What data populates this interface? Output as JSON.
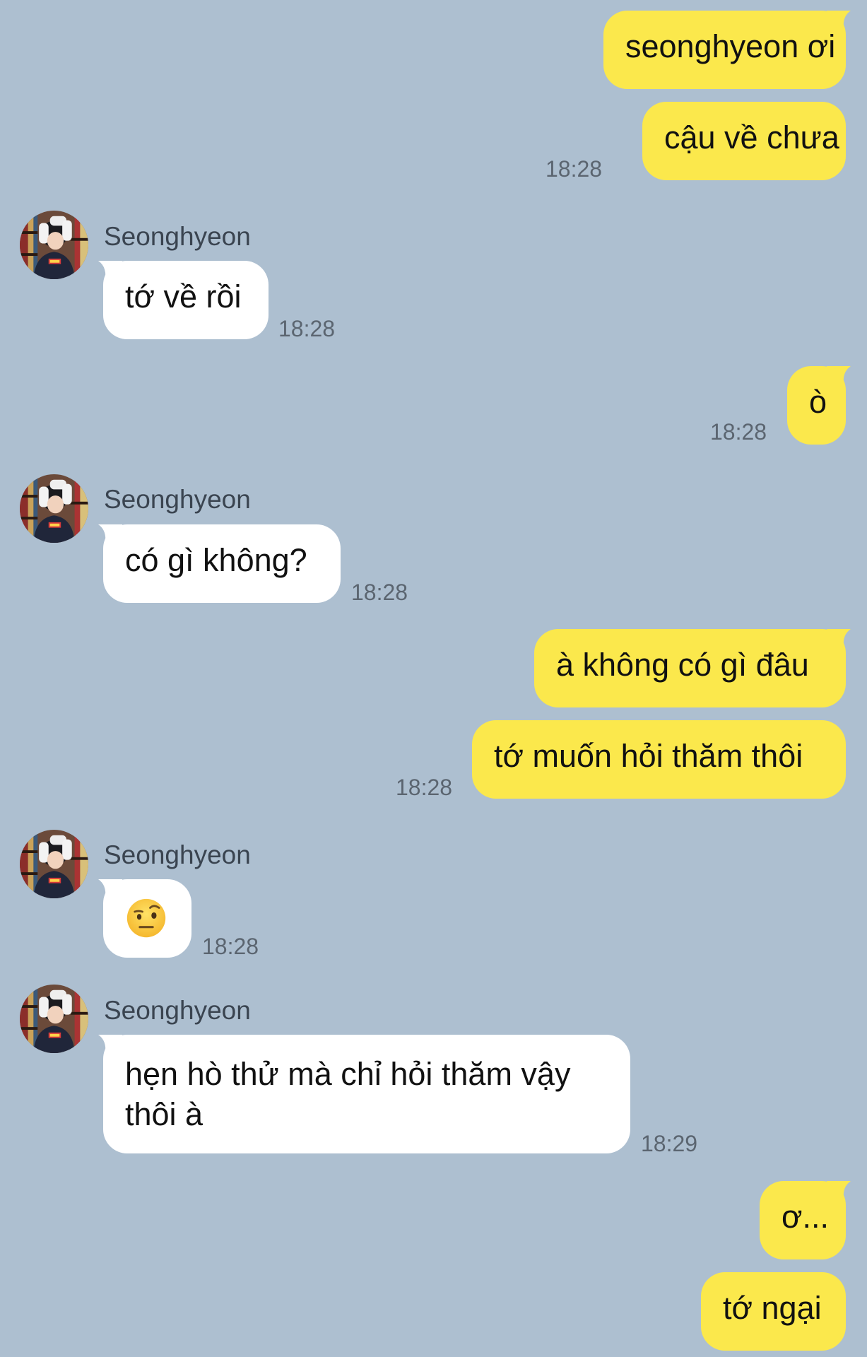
{
  "contact": {
    "name": "Seonghyeon"
  },
  "colors": {
    "background": "#adbfd0",
    "my_bubble": "#fbe84c",
    "their_bubble": "#ffffff"
  },
  "messages": [
    {
      "sender": "me",
      "text": "seonghyeon ơi",
      "time": ""
    },
    {
      "sender": "me",
      "text": "cậu về chưa",
      "time": "18:28"
    },
    {
      "sender": "them",
      "text": "tớ về rồi",
      "time": "18:28"
    },
    {
      "sender": "me",
      "text": "ò",
      "time": "18:28"
    },
    {
      "sender": "them",
      "text": "có gì không?",
      "time": "18:28"
    },
    {
      "sender": "me",
      "text": "à không có gì đâu",
      "time": ""
    },
    {
      "sender": "me",
      "text": "tớ muốn hỏi thăm thôi",
      "time": "18:28"
    },
    {
      "sender": "them",
      "text": "",
      "emoji": "face-with-raised-eyebrow-icon",
      "time": "18:28"
    },
    {
      "sender": "them",
      "text": "hẹn hò thử mà chỉ hỏi thăm vậy thôi à",
      "time": "18:29"
    },
    {
      "sender": "me",
      "text": "ơ...",
      "time": ""
    },
    {
      "sender": "me",
      "text": "tớ ngại",
      "time": ""
    }
  ]
}
